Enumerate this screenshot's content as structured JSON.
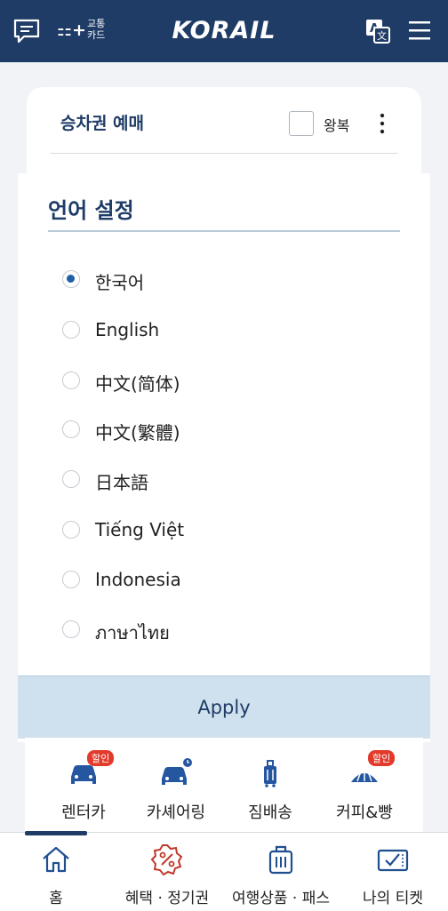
{
  "header": {
    "transit_card_line1": "교통",
    "transit_card_line2": "카드",
    "brand": "KORAIL"
  },
  "booking_card": {
    "title": "승차권 예매",
    "round_trip_label": "왕복"
  },
  "language_modal": {
    "title": "언어 설정",
    "options": [
      {
        "label": "한국어",
        "selected": true
      },
      {
        "label": "English",
        "selected": false
      },
      {
        "label": "中文(简体)",
        "selected": false
      },
      {
        "label": "中文(繁體)",
        "selected": false
      },
      {
        "label": "日本語",
        "selected": false
      },
      {
        "label": "Tiếng Việt",
        "selected": false
      },
      {
        "label": "Indonesia",
        "selected": false
      },
      {
        "label": "ภาษาไทย",
        "selected": false
      }
    ],
    "apply_label": "Apply"
  },
  "services": {
    "discount_badge": "할인",
    "items": [
      {
        "label": "렌터카",
        "icon": "rental-car-icon"
      },
      {
        "label": "카셰어링",
        "icon": "car-sharing-icon"
      },
      {
        "label": "짐배송",
        "icon": "luggage-delivery-icon"
      },
      {
        "label": "커피&빵",
        "icon": "coffee-bread-icon"
      }
    ]
  },
  "bottom_nav": {
    "items": [
      {
        "label": "홈",
        "icon": "home-icon"
      },
      {
        "label": "혜택 · 정기권",
        "icon": "discount-icon"
      },
      {
        "label": "여행상품 · 패스",
        "icon": "travel-bag-icon"
      },
      {
        "label": "나의 티켓",
        "icon": "my-ticket-icon"
      }
    ]
  },
  "colors": {
    "header_bg": "#1f3c67",
    "apply_bg": "#cfe1ee",
    "accent": "#1f5fa6",
    "badge": "#e23b2c"
  }
}
